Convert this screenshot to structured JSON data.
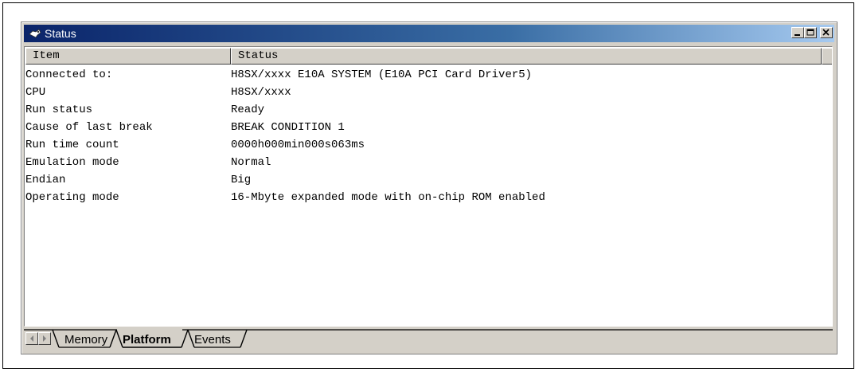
{
  "window": {
    "title": "Status"
  },
  "columns": {
    "item": "Item",
    "status": "Status"
  },
  "rows": [
    {
      "item": "Connected to:",
      "status": "H8SX/xxxx E10A SYSTEM (E10A PCI Card Driver5)"
    },
    {
      "item": "CPU",
      "status": "H8SX/xxxx"
    },
    {
      "item": "Run status",
      "status": "Ready"
    },
    {
      "item": "Cause of last break",
      "status": "BREAK CONDITION 1"
    },
    {
      "item": "Run time count",
      "status": "0000h000min000s063ms"
    },
    {
      "item": "Emulation mode",
      "status": "Normal"
    },
    {
      "item": "Endian",
      "status": "Big"
    },
    {
      "item": "Operating mode",
      "status": "16-Mbyte expanded mode with on-chip ROM enabled"
    }
  ],
  "tabs": [
    {
      "label": "Memory",
      "active": false
    },
    {
      "label": "Platform",
      "active": true
    },
    {
      "label": "Events",
      "active": false
    }
  ],
  "colors": {
    "title_start": "#0a246a",
    "title_end": "#a6caf0",
    "face": "#d4d0c8"
  }
}
